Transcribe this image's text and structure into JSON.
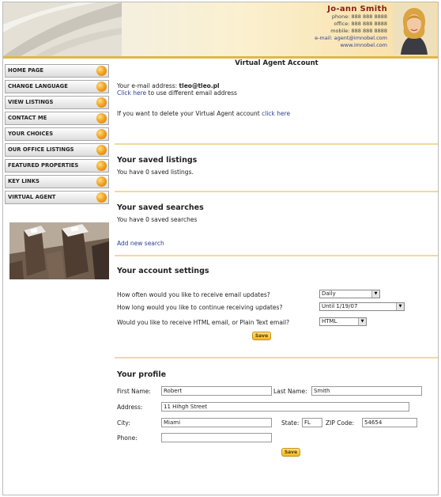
{
  "agent": {
    "name": "Jo-ann Smith",
    "phone": "phone: 888 888 8888",
    "office": "office: 888 888 8888",
    "mobile": "mobile: 888 888 8888",
    "email": "e-mail: agent@imnobel.com",
    "website": "www.imnobel.com"
  },
  "sidebar": {
    "items": [
      {
        "label": "HOME PAGE"
      },
      {
        "label": "CHANGE LANGUAGE"
      },
      {
        "label": "VIEW LISTINGS"
      },
      {
        "label": "CONTACT ME"
      },
      {
        "label": "YOUR CHOICES"
      },
      {
        "label": "OUR OFFICE LISTINGS"
      },
      {
        "label": "FEATURED PROPERTIES"
      },
      {
        "label": "KEY LINKS"
      },
      {
        "label": "VIRTUAL AGENT"
      }
    ]
  },
  "main": {
    "title": "Virtual Agent Account",
    "email_prefix": "Your e-mail address: ",
    "email_value": "tleo@tleo.pl",
    "click_here": "Click here",
    "use_different": " to use different email address",
    "delete_text": "If you want to delete your Virtual Agent account ",
    "delete_link": "click here"
  },
  "saved_listings": {
    "title": "Your saved listings",
    "text": "You have 0 saved listings."
  },
  "saved_searches": {
    "title": "Your saved searches",
    "text": "You have 0 saved searches",
    "add_link": "Add new search"
  },
  "account_settings": {
    "title": "Your account settings",
    "q_frequency": "How often would you like to receive email updates?",
    "frequency_value": "Daily",
    "q_duration": "How long would you like to continue receiving updates?",
    "duration_value": "Until 1/19/07",
    "q_format": "Would you like to receive HTML email, or Plain Text email?",
    "format_value": "HTML",
    "save_label": "Save"
  },
  "profile": {
    "title": "Your profile",
    "first_name_label": "First Name:",
    "first_name": "Robert",
    "last_name_label": "Last Name:",
    "last_name": "Smith",
    "address_label": "Address:",
    "address": "11 Hihgh Street",
    "city_label": "City:",
    "city": "Miami",
    "state_label": "State:",
    "state": "FL",
    "zip_label": "ZIP Code:",
    "zip": "54654",
    "phone_label": "Phone:",
    "phone": "",
    "save_label": "Save"
  },
  "colors": {
    "accent": "#f5a623",
    "link": "#2c3e99",
    "divider": "#f2d99a",
    "agent_name": "#8b1a1a"
  },
  "icons": {
    "nav_bullet": "orange-orb-icon",
    "dropdown": "chevron-down-icon"
  }
}
